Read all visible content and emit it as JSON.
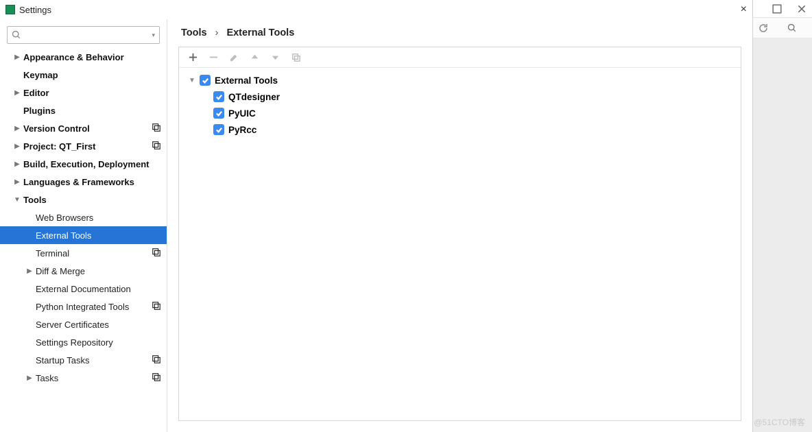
{
  "window": {
    "title": "Settings"
  },
  "search": {
    "placeholder": ""
  },
  "sidebar": {
    "items": [
      {
        "label": "Appearance & Behavior",
        "indent": 0,
        "bold": true,
        "arrow": "right",
        "profile": false,
        "selected": false
      },
      {
        "label": "Keymap",
        "indent": 0,
        "bold": true,
        "arrow": "none",
        "profile": false,
        "selected": false
      },
      {
        "label": "Editor",
        "indent": 0,
        "bold": true,
        "arrow": "right",
        "profile": false,
        "selected": false
      },
      {
        "label": "Plugins",
        "indent": 0,
        "bold": true,
        "arrow": "none",
        "profile": false,
        "selected": false
      },
      {
        "label": "Version Control",
        "indent": 0,
        "bold": true,
        "arrow": "right",
        "profile": true,
        "selected": false
      },
      {
        "label": "Project: QT_First",
        "indent": 0,
        "bold": true,
        "arrow": "right",
        "profile": true,
        "selected": false
      },
      {
        "label": "Build, Execution, Deployment",
        "indent": 0,
        "bold": true,
        "arrow": "right",
        "profile": false,
        "selected": false
      },
      {
        "label": "Languages & Frameworks",
        "indent": 0,
        "bold": true,
        "arrow": "right",
        "profile": false,
        "selected": false
      },
      {
        "label": "Tools",
        "indent": 0,
        "bold": true,
        "arrow": "down",
        "profile": false,
        "selected": false
      },
      {
        "label": "Web Browsers",
        "indent": 1,
        "bold": false,
        "arrow": "none",
        "profile": false,
        "selected": false
      },
      {
        "label": "External Tools",
        "indent": 1,
        "bold": false,
        "arrow": "none",
        "profile": false,
        "selected": true
      },
      {
        "label": "Terminal",
        "indent": 1,
        "bold": false,
        "arrow": "none",
        "profile": true,
        "selected": false
      },
      {
        "label": "Diff & Merge",
        "indent": 1,
        "bold": false,
        "arrow": "right",
        "profile": false,
        "selected": false
      },
      {
        "label": "External Documentation",
        "indent": 1,
        "bold": false,
        "arrow": "none",
        "profile": false,
        "selected": false
      },
      {
        "label": "Python Integrated Tools",
        "indent": 1,
        "bold": false,
        "arrow": "none",
        "profile": true,
        "selected": false
      },
      {
        "label": "Server Certificates",
        "indent": 1,
        "bold": false,
        "arrow": "none",
        "profile": false,
        "selected": false
      },
      {
        "label": "Settings Repository",
        "indent": 1,
        "bold": false,
        "arrow": "none",
        "profile": false,
        "selected": false
      },
      {
        "label": "Startup Tasks",
        "indent": 1,
        "bold": false,
        "arrow": "none",
        "profile": true,
        "selected": false
      },
      {
        "label": "Tasks",
        "indent": 1,
        "bold": false,
        "arrow": "right",
        "profile": true,
        "selected": false
      }
    ]
  },
  "breadcrumb": {
    "parts": [
      "Tools",
      "External Tools"
    ]
  },
  "toolbar": {
    "add": {
      "enabled": true
    },
    "remove": {
      "enabled": false
    },
    "edit": {
      "enabled": false
    },
    "up": {
      "enabled": false
    },
    "down": {
      "enabled": false
    },
    "copy": {
      "enabled": false
    }
  },
  "tree": {
    "root": {
      "label": "External Tools",
      "checked": true,
      "expanded": true
    },
    "children": [
      {
        "label": "QTdesigner",
        "checked": true
      },
      {
        "label": "PyUIC",
        "checked": true
      },
      {
        "label": "PyRcc",
        "checked": true
      }
    ]
  },
  "watermark": "@51CTO博客"
}
